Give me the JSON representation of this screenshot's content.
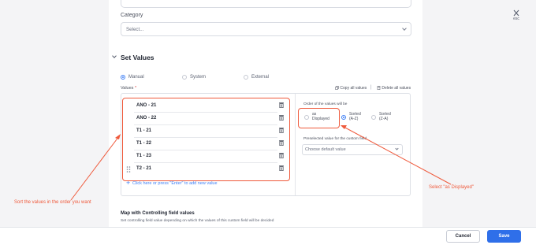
{
  "category": {
    "label": "Category",
    "placeholder": "Select..."
  },
  "section": {
    "title": "Set Values"
  },
  "value_type": {
    "options": [
      "Manual",
      "System",
      "External"
    ],
    "selected": "Manual"
  },
  "values_header": {
    "label": "Values",
    "required_mark": "*",
    "copy_all": "Copy all values",
    "separator": "|",
    "delete_all": "Delete all values"
  },
  "values": [
    {
      "label": "ANO - 21"
    },
    {
      "label": "ANO - 22"
    },
    {
      "label": "T1 - 21"
    },
    {
      "label": "T1 - 22"
    },
    {
      "label": "T1 - 23"
    },
    {
      "label": "T2 - 21"
    }
  ],
  "add_new": {
    "label": "Click here or press \"Enter\" to add new value"
  },
  "order": {
    "label": "Order of the values will be",
    "options": [
      {
        "line1": "as",
        "line2": "Displayed"
      },
      {
        "line1": "Sorted",
        "line2": "(A-Z)"
      },
      {
        "line1": "Sorted",
        "line2": "(Z-A)"
      }
    ],
    "selected": "Sorted (A-Z)"
  },
  "preselected": {
    "label": "Preselected value for the custom field",
    "placeholder": "Choose default value"
  },
  "mapping": {
    "title": "Map with Controlling field values",
    "subtitle": "Set controlling field value depending on which the values of this custom field will be decided"
  },
  "footer": {
    "cancel_label": "Cancel",
    "save_label": "Save"
  },
  "close": {
    "esc_label": "esc"
  },
  "annotations": {
    "left_note": "Sort the values in the order you want",
    "right_note": "Select \"as Displayed\"",
    "color": "#ef5a3c"
  },
  "colors": {
    "accent": "#2f6fe9",
    "radio_selected": "#3f7ff5"
  }
}
